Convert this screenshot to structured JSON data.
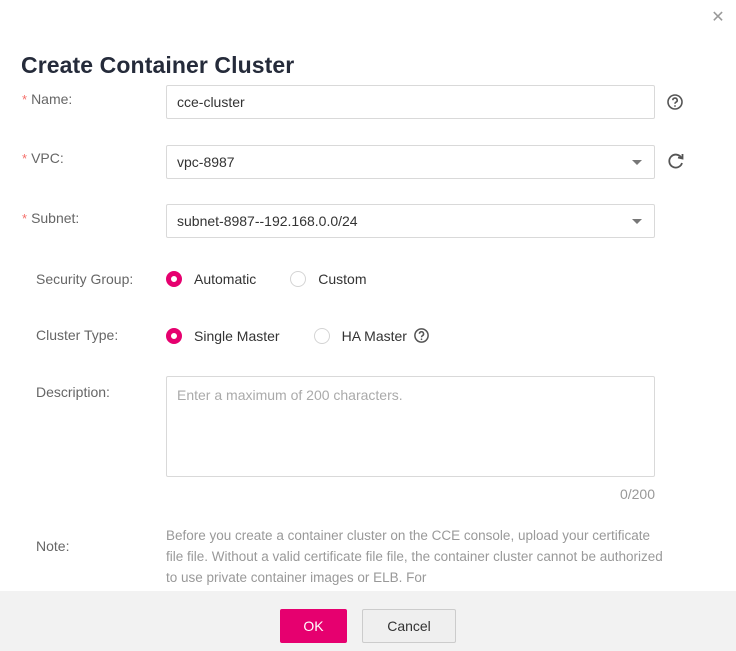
{
  "dialog": {
    "title": "Create Container Cluster",
    "close_icon": "close-icon"
  },
  "form": {
    "name": {
      "label": "Name:",
      "required": true,
      "value": "cce-cluster",
      "help_icon": "help-icon"
    },
    "vpc": {
      "label": "VPC:",
      "required": true,
      "value": "vpc-8987",
      "refresh_icon": "refresh-icon"
    },
    "subnet": {
      "label": "Subnet:",
      "required": true,
      "value": "subnet-8987--192.168.0.0/24"
    },
    "security_group": {
      "label": "Security Group:",
      "options": [
        {
          "label": "Automatic",
          "selected": true
        },
        {
          "label": "Custom",
          "selected": false
        }
      ]
    },
    "cluster_type": {
      "label": "Cluster Type:",
      "options": [
        {
          "label": "Single Master",
          "selected": true
        },
        {
          "label": "HA Master",
          "selected": false
        }
      ],
      "help_icon": "help-icon"
    },
    "description": {
      "label": "Description:",
      "placeholder": "Enter a maximum of 200 characters.",
      "counter": "0/200"
    },
    "note": {
      "label": "Note:",
      "text": "Before you create a container cluster on the CCE console, upload your certificate file file. Without a valid certificate file file, the container cluster cannot be authorized to use private container images or ELB. For"
    }
  },
  "footer": {
    "ok_label": "OK",
    "cancel_label": "Cancel"
  },
  "colors": {
    "accent": "#e6006f",
    "required_star": "#f66f6a",
    "footer_bg": "#f2f2f2"
  }
}
